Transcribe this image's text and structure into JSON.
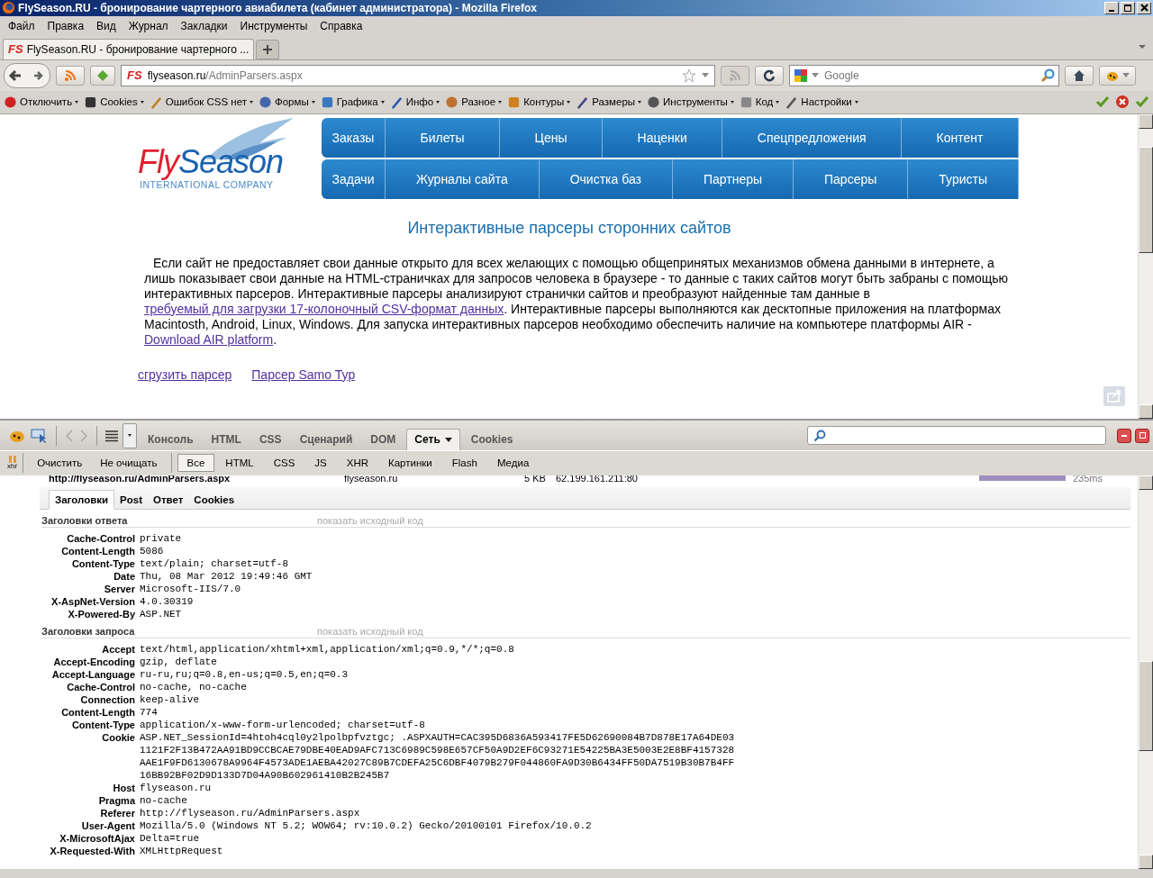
{
  "window": {
    "title": "FlySeason.RU - бронирование чартерного авиабилета (кабинет администратора) - Mozilla Firefox"
  },
  "menu": [
    "Файл",
    "Правка",
    "Вид",
    "Журнал",
    "Закладки",
    "Инструменты",
    "Справка"
  ],
  "tabs": [
    {
      "badge": "FS",
      "label": "FlySeason.RU - бронирование чартерного ...",
      "selected": true
    }
  ],
  "address": {
    "badge": "FS",
    "host": "flyseason.ru",
    "path": "/AdminParsers.aspx"
  },
  "search": {
    "placeholder": "Google"
  },
  "toolbar_items": [
    "Отключить",
    "Cookies",
    "Ошибок CSS нет",
    "Формы",
    "Графика",
    "Инфо",
    "Разное",
    "Контуры",
    "Размеры",
    "Инструменты",
    "Код",
    "Настройки"
  ],
  "page": {
    "logo": {
      "brand_a": "Fly",
      "brand_b": "Season",
      "tagline": "INTERNATIONAL COMPANY"
    },
    "nav_rows": [
      [
        "Заказы",
        "Билеты",
        "Цены",
        "Наценки",
        "Спецпредложения",
        "Контент"
      ],
      [
        "Задачи",
        "Журналы сайта",
        "Очистка баз",
        "Партнеры",
        "Парсеры",
        "Туристы"
      ]
    ],
    "heading": "Интерактивные парсеры сторонних сайтов",
    "paragraph": [
      {
        "text": "Если сайт не предоставляет свои данные открыто для всех желающих с помощью общепринятых механизмов обмена данными в интернете, а лишь показывает свои данные на HTML-страничках для запросов человека в браузере - то данные с таких сайтов могут быть забраны с помощью интерактивных парсеров. Интерактивные парсеры анализируют странички сайтов и преобразуют найденные там данные в ",
        "kind": "text"
      },
      {
        "text": "требуемый для загрузки 17-колоночный CSV-формат данных",
        "kind": "link"
      },
      {
        "text": ". Интерактивные парсеры выполняются как десктопные приложения на платформах Macintosth, Android, Linux, Windows. Для запуска интерактивных парсеров необходимо обеспечить наличие на компьютере платформы AIR - ",
        "kind": "text"
      },
      {
        "text": "Download AIR platform",
        "kind": "link"
      },
      {
        "text": ".",
        "kind": "text"
      }
    ],
    "links": [
      "сгрузить парсер",
      "Парсер Samo Тур"
    ]
  },
  "firebug": {
    "tabs": [
      {
        "label": "Консоль",
        "selected": false
      },
      {
        "label": "HTML",
        "selected": false
      },
      {
        "label": "CSS",
        "selected": false
      },
      {
        "label": "Сценарий",
        "selected": false
      },
      {
        "label": "DOM",
        "selected": false
      },
      {
        "label": "Сеть",
        "selected": true
      },
      {
        "label": "Cookies",
        "selected": false
      }
    ],
    "xhr_label": "xhr",
    "clear": "Очистить",
    "persist": "Не очищать",
    "filters": [
      {
        "label": "Все",
        "selected": true
      },
      {
        "label": "HTML",
        "selected": false
      },
      {
        "label": "CSS",
        "selected": false
      },
      {
        "label": "JS",
        "selected": false
      },
      {
        "label": "XHR",
        "selected": false
      },
      {
        "label": "Картинки",
        "selected": false
      },
      {
        "label": "Flash",
        "selected": false
      },
      {
        "label": "Медиа",
        "selected": false
      }
    ],
    "request": {
      "url": "http://flyseason.ru/AdminParsers.aspx",
      "domain": "flyseason.ru",
      "size": "5 KB",
      "remote": "62.199.161.211:80",
      "time": "235ms"
    },
    "detail_tabs": [
      {
        "label": "Заголовки",
        "selected": true
      },
      {
        "label": "Post",
        "selected": false
      },
      {
        "label": "Ответ",
        "selected": false
      },
      {
        "label": "Cookies",
        "selected": false
      }
    ],
    "sections": [
      {
        "title": "Заголовки ответа",
        "source_link": "показать исходный код",
        "headers": [
          {
            "name": "Cache-Control",
            "value": "private"
          },
          {
            "name": "Content-Length",
            "value": "5086"
          },
          {
            "name": "Content-Type",
            "value": "text/plain; charset=utf-8"
          },
          {
            "name": "Date",
            "value": "Thu, 08 Mar 2012 19:49:46 GMT"
          },
          {
            "name": "Server",
            "value": "Microsoft-IIS/7.0"
          },
          {
            "name": "X-AspNet-Version",
            "value": "4.0.30319"
          },
          {
            "name": "X-Powered-By",
            "value": "ASP.NET"
          }
        ]
      },
      {
        "title": "Заголовки запроса",
        "source_link": "показать исходный код",
        "headers": [
          {
            "name": "Accept",
            "value": "text/html,application/xhtml+xml,application/xml;q=0.9,*/*;q=0.8"
          },
          {
            "name": "Accept-Encoding",
            "value": "gzip, deflate"
          },
          {
            "name": "Accept-Language",
            "value": "ru-ru,ru;q=0.8,en-us;q=0.5,en;q=0.3"
          },
          {
            "name": "Cache-Control",
            "value": "no-cache, no-cache"
          },
          {
            "name": "Connection",
            "value": "keep-alive"
          },
          {
            "name": "Content-Length",
            "value": "774"
          },
          {
            "name": "Content-Type",
            "value": "application/x-www-form-urlencoded; charset=utf-8"
          },
          {
            "name": "Cookie",
            "value": "ASP.NET_SessionId=4htoh4cql0y2lpolbpfvztgc; .ASPXAUTH=CAC395D6836A593417FE5D62690084B7D878E17A64DE031121F2F13B472AA91BD9CCBCAE79DBE40EAD9AFC713C6989C598E657CF50A9D2EF6C93271E54225BA3E5003E2E8BF4157328AAE1F9FD6130678A9964F4573ADE1AEBA42027C89B7CDEFA25C6DBF4079B279F044860FA9D30B6434FF50DA7519B30B7B4FF16BB92BF02D9D133D7D04A90B602961410B2B245B7"
          },
          {
            "name": "Host",
            "value": "flyseason.ru"
          },
          {
            "name": "Pragma",
            "value": "no-cache"
          },
          {
            "name": "Referer",
            "value": "http://flyseason.ru/AdminParsers.aspx"
          },
          {
            "name": "User-Agent",
            "value": "Mozilla/5.0 (Windows NT 5.2; WOW64; rv:10.0.2) Gecko/20100101 Firefox/10.0.2"
          },
          {
            "name": "X-MicrosoftAjax",
            "value": "Delta=true"
          },
          {
            "name": "X-Requested-With",
            "value": "XMLHttpRequest"
          }
        ]
      }
    ]
  }
}
